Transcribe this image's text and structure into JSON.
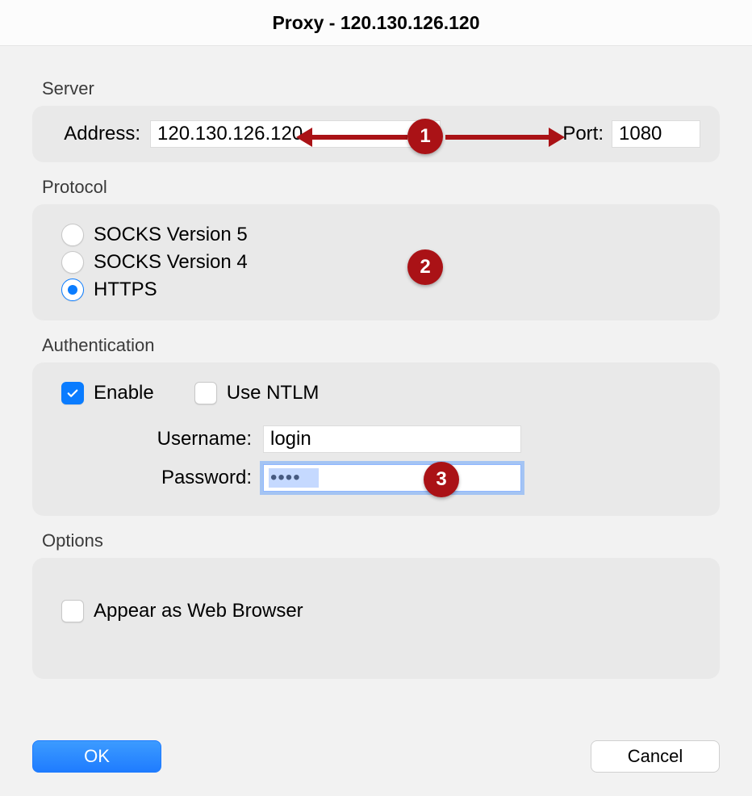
{
  "title": "Proxy - 120.130.126.120",
  "annotations": {
    "b1": "1",
    "b2": "2",
    "b3": "3"
  },
  "server": {
    "section_label": "Server",
    "address_label": "Address:",
    "address_value": "120.130.126.120",
    "port_label": "Port:",
    "port_value": "1080"
  },
  "protocol": {
    "section_label": "Protocol",
    "options": {
      "socks5": "SOCKS Version 5",
      "socks4": "SOCKS Version 4",
      "https": "HTTPS"
    },
    "selected": "https"
  },
  "auth": {
    "section_label": "Authentication",
    "enable_label": "Enable",
    "enable_checked": true,
    "ntlm_label": "Use NTLM",
    "ntlm_checked": false,
    "username_label": "Username:",
    "username_value": "login",
    "password_label": "Password:",
    "password_mask": "••••"
  },
  "options": {
    "section_label": "Options",
    "appear_label": "Appear as Web Browser",
    "appear_checked": false
  },
  "buttons": {
    "ok": "OK",
    "cancel": "Cancel"
  }
}
